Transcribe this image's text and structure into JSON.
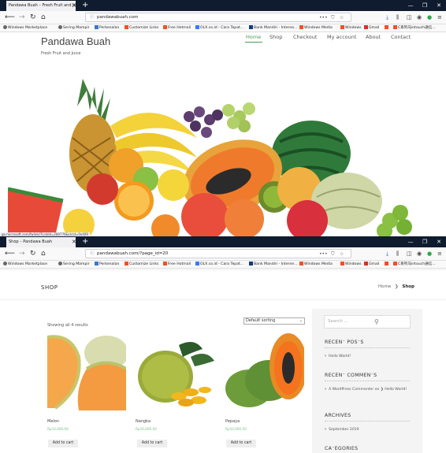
{
  "win1": {
    "tab_title": "Pandawa Buah – Fresh Fruit and Juice",
    "url": "pandawabuah.com",
    "site_title": "Pandawa Buah",
    "tagline": "Fresh Fruit and Juice",
    "menu": [
      "Home",
      "Shop",
      "Checkout",
      "My account",
      "About",
      "Contact"
    ],
    "active_menu": "Home",
    "status_url": "go.microsoft.com/fwlink/?LinkId=280776&clcid=0x409"
  },
  "win2": {
    "tab_title": "Shop – Pandawa Buah",
    "url": "pandawabuah.com/?page_id=20",
    "page_heading": "SHOP",
    "breadcrumb": {
      "home": "Home",
      "current": "Shop",
      "sep": "❯"
    },
    "result_count": "Showing all 4 results",
    "sort_value": "Default sorting",
    "products": [
      {
        "name": "Melon",
        "price": "Rp10,000.00",
        "button": "Add to cart"
      },
      {
        "name": "Nangka",
        "price": "Rp10,000.00",
        "button": "Add to cart"
      },
      {
        "name": "Pepaya",
        "price": "Rp10,000.00",
        "button": "Add to cart"
      }
    ],
    "sidebar": {
      "search_placeholder": "Search ...",
      "recent_posts_title": "RECEN⁻ POS⁻S",
      "recent_posts": [
        "Hello World!"
      ],
      "recent_comments_title": "RECEN⁻ COMMEN⁻S",
      "recent_comment": "A WordPress Commenter on ❯ Hello World!",
      "archives_title": "ARCHIVES",
      "archives": [
        "September 2019"
      ],
      "categories_title": "CA⁻EGORIES"
    }
  },
  "bookmarks": [
    {
      "label": "Windows Marketplace",
      "icon": "gear-icon"
    },
    {
      "label": "Sering Mampir",
      "icon": "gear-icon"
    },
    {
      "label": "Perkenalan",
      "icon": "globe-icon"
    },
    {
      "label": "Customize Links",
      "icon": "ms-tiles-icon"
    },
    {
      "label": "Free Hotmail",
      "icon": "ms-tiles-icon"
    },
    {
      "label": "OLX.co.id - Cara Tepat...",
      "icon": "olx-icon"
    },
    {
      "label": "Bank Mandiri - Interne...",
      "icon": "bank-icon"
    },
    {
      "label": "Windows Media",
      "icon": "ms-tiles-icon"
    },
    {
      "label": "Windows",
      "icon": "ms-tiles-icon"
    },
    {
      "label": "Gmail",
      "icon": "gmail-icon"
    },
    {
      "label": "",
      "icon": "ms-tiles-icon"
    },
    {
      "label": "C系列马intouch通信...",
      "icon": "ms-tiles-icon"
    }
  ],
  "colors": {
    "accent_green": "#4a9e57",
    "titlebar": "#0f1b2e",
    "price_green": "#7bbf87"
  }
}
